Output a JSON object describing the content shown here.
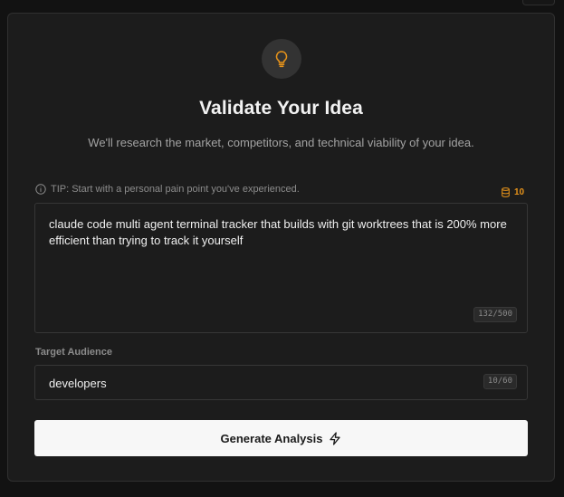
{
  "header": {
    "icon": "lightbulb-icon",
    "title": "Validate Your Idea",
    "subtitle": "We'll research the market, competitors, and technical viability of your idea."
  },
  "tip": {
    "icon": "info-icon",
    "text": "TIP: Start with a personal pain point you've experienced."
  },
  "credits": {
    "icon": "database-icon",
    "value": "10",
    "color": "#e8941a"
  },
  "idea_input": {
    "value": "claude code multi agent terminal tracker that builds with git worktrees that is 200% more efficient than trying to track it yourself",
    "counter": "132/500"
  },
  "audience": {
    "label": "Target Audience",
    "value": "developers",
    "counter": "10/60"
  },
  "generate_button": {
    "label": "Generate Analysis",
    "icon": "lightning-icon"
  }
}
